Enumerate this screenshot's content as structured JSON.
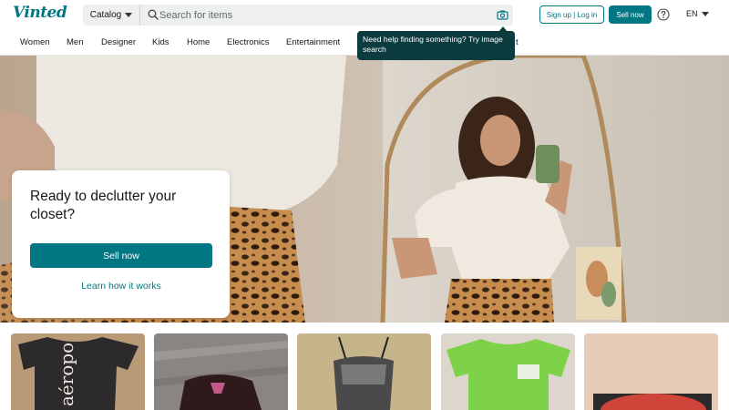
{
  "header": {
    "logo": "Vinted",
    "catalog_label": "Catalog",
    "search_placeholder": "Search for items",
    "signup_label": "Sign up | Log in",
    "sell_label": "Sell now",
    "language": "EN"
  },
  "nav": {
    "items": [
      "Women",
      "Men",
      "Designer",
      "Kids",
      "Home",
      "Electronics",
      "Entertainment",
      "t"
    ]
  },
  "tooltip": {
    "text": "Need help finding something? Try image search"
  },
  "hero": {
    "title": "Ready to declutter your closet?",
    "sell_label": "Sell now",
    "learn_label": "Learn how it works"
  },
  "items": [
    {
      "name": "black-graphic-tee",
      "print": "aéropo"
    },
    {
      "name": "dark-knit-top"
    },
    {
      "name": "sequin-corset-top"
    },
    {
      "name": "green-tee"
    },
    {
      "name": "orange-red-item"
    }
  ],
  "colors": {
    "brand": "#007782",
    "tooltip_bg": "#0c3b40"
  }
}
